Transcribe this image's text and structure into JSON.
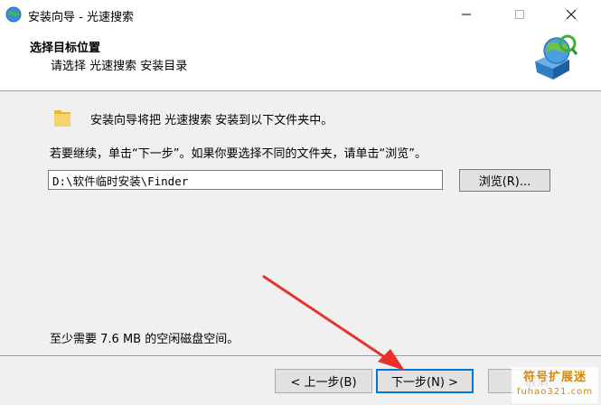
{
  "window": {
    "title": "安装向导 - 光速搜索"
  },
  "header": {
    "title": "选择目标位置",
    "subtitle": "请选择 光速搜索 安装目录"
  },
  "body": {
    "info_line": "安装向导将把 光速搜索 安装到以下文件夹中。",
    "instruction": "若要继续，单击“下一步”。如果你要选择不同的文件夹，请单击“浏览”。",
    "install_path": "D:\\软件临时安装\\Finder",
    "browse_label": "浏览(R)...",
    "disk_space": "至少需要 7.6 MB 的空闲磁盘空间。"
  },
  "footer": {
    "back_label": "< 上一步(B)",
    "next_label": "下一步(N) >",
    "cancel_label": "取消"
  },
  "watermark": {
    "top": "符号扩展迷",
    "bottom": "fuhao321.com"
  },
  "colors": {
    "annotation_arrow": "#e8312b",
    "default_button_border": "#0078d7",
    "watermark": "#d98a00"
  }
}
